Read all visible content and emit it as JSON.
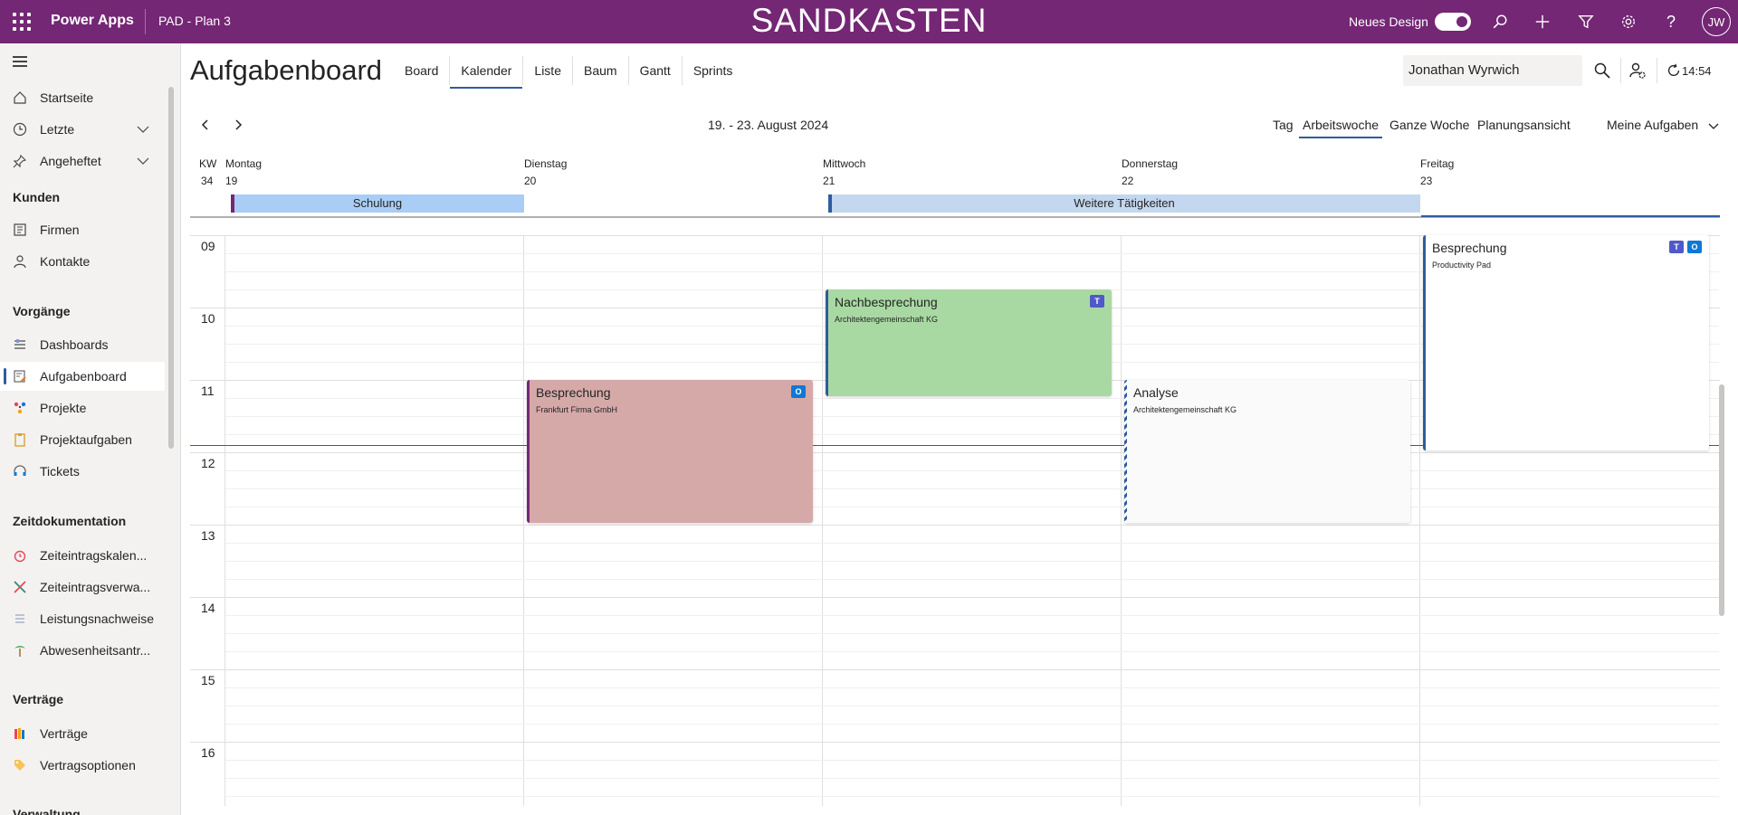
{
  "topbar": {
    "brand": "Power Apps",
    "app_name": "PAD - Plan 3",
    "environment_banner": "SANDKASTEN",
    "new_design_label": "Neues Design",
    "user_initials": "JW",
    "color": "#742774"
  },
  "sidebar": {
    "items_top": [
      {
        "label": "Startseite",
        "icon": "home-icon"
      },
      {
        "label": "Letzte",
        "icon": "clock-icon"
      },
      {
        "label": "Angeheftet",
        "icon": "pin-icon"
      }
    ],
    "groups": [
      {
        "title": "Kunden",
        "items": [
          {
            "label": "Firmen",
            "icon": "company-icon"
          },
          {
            "label": "Kontakte",
            "icon": "person-icon"
          }
        ]
      },
      {
        "title": "Vorgänge",
        "items": [
          {
            "label": "Dashboards",
            "icon": "dashboard-icon"
          },
          {
            "label": "Aufgabenboard",
            "icon": "taskboard-icon"
          },
          {
            "label": "Projekte",
            "icon": "projects-icon"
          },
          {
            "label": "Projektaufgaben",
            "icon": "clipboard-icon"
          },
          {
            "label": "Tickets",
            "icon": "headset-icon"
          }
        ]
      },
      {
        "title": "Zeitdokumentation",
        "items": [
          {
            "label": "Zeiteintragskalen...",
            "icon": "alarm-icon"
          },
          {
            "label": "Zeiteintragsverwa...",
            "icon": "tools-icon"
          },
          {
            "label": "Leistungsnachweise",
            "icon": "list-icon"
          },
          {
            "label": "Abwesenheitsantr...",
            "icon": "palm-icon"
          }
        ]
      },
      {
        "title": "Verträge",
        "items": [
          {
            "label": "Verträge",
            "icon": "books-icon"
          },
          {
            "label": "Vertragsoptionen",
            "icon": "tag-icon"
          }
        ]
      },
      {
        "title": "Verwaltung",
        "items": []
      }
    ],
    "active_item": "Aufgabenboard"
  },
  "header": {
    "title": "Aufgabenboard",
    "tabs": [
      {
        "label": "Board"
      },
      {
        "label": "Kalender"
      },
      {
        "label": "Liste"
      },
      {
        "label": "Baum"
      },
      {
        "label": "Gantt"
      },
      {
        "label": "Sprints"
      }
    ],
    "active_tab": "Kalender",
    "user_name": "Jonathan Wyrwich",
    "time": "14:54"
  },
  "calendar": {
    "range_label": "19. - 23. August 2024",
    "views": [
      "Tag",
      "Arbeitswoche",
      "Ganze Woche",
      "Planungsansicht"
    ],
    "active_view": "Arbeitswoche",
    "filter_label": "Meine Aufgaben",
    "kw_label": "KW",
    "kw_number": "34",
    "days": [
      {
        "name": "Montag",
        "date": "19"
      },
      {
        "name": "Dienstag",
        "date": "20"
      },
      {
        "name": "Mittwoch",
        "date": "21"
      },
      {
        "name": "Donnerstag",
        "date": "22"
      },
      {
        "name": "Freitag",
        "date": "23"
      }
    ],
    "all_day_events": [
      {
        "title": "Schulung",
        "day_start": 0,
        "day_end": 0,
        "fill": "#a9cdf5",
        "accent": "#742774"
      },
      {
        "title": "Weitere Tätigkeiten",
        "day_start": 2,
        "day_end": 3,
        "fill": "#c3d7ef",
        "accent": "#2f5c9e"
      }
    ],
    "hours": [
      "09",
      "10",
      "11",
      "12",
      "13",
      "14",
      "15",
      "16"
    ],
    "events": [
      {
        "title": "Besprechung",
        "subtitle": "Frankfurt Firma GmbH",
        "day": 1,
        "start": 11.0,
        "end": 13.0,
        "fill": "#d6a9a9",
        "accent": "#742774",
        "icons": [
          "outlook"
        ]
      },
      {
        "title": "Nachbesprechung",
        "subtitle": "Architektengemeinschaft KG",
        "day": 2,
        "start": 9.75,
        "end": 11.25,
        "fill": "#a9d9a2",
        "accent": "#2f5c9e",
        "icons": [
          "teams"
        ]
      },
      {
        "title": "Analyse",
        "subtitle": "Architektengemeinschaft KG",
        "day": 3,
        "start": 11.0,
        "end": 13.0,
        "fill": "#fafafa",
        "accent": "striped",
        "icons": []
      },
      {
        "title": "Besprechung",
        "subtitle": "Productivity Pad",
        "day": 4,
        "start": 9.0,
        "end": 12.0,
        "fill": "#ffffff",
        "accent": "#2f5c9e",
        "icons": [
          "teams",
          "outlook"
        ]
      }
    ],
    "now_hour": 12.0
  }
}
